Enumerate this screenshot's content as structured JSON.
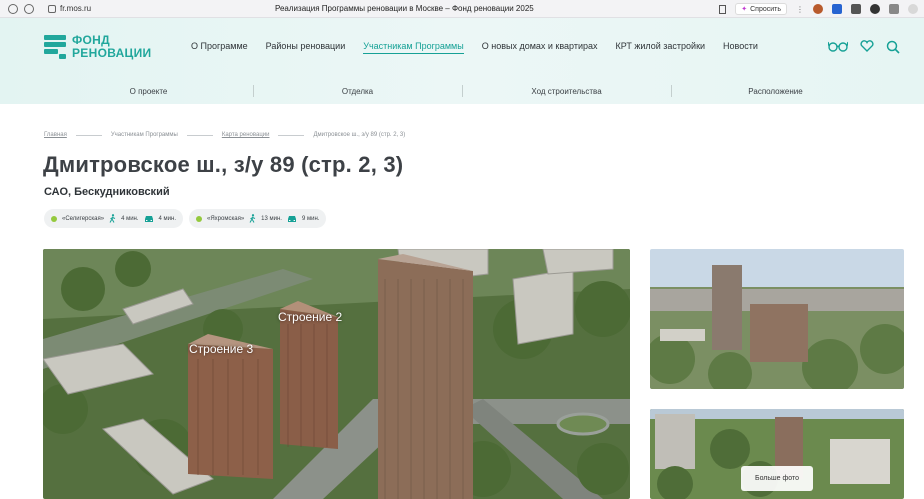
{
  "browser": {
    "url": "fr.mos.ru",
    "tab_title": "Реализация Программы реновации в Москве – Фонд реновации 2025",
    "ask_label": "Спросить"
  },
  "logo": {
    "line1": "ФОНД",
    "line2": "РЕНОВАЦИИ"
  },
  "main_nav": [
    {
      "label": "О Программе",
      "active": false
    },
    {
      "label": "Районы реновации",
      "active": false
    },
    {
      "label": "Участникам Программы",
      "active": true
    },
    {
      "label": "О новых домах и квартирах",
      "active": false
    },
    {
      "label": "КРТ жилой застройки",
      "active": false
    },
    {
      "label": "Новости",
      "active": false
    }
  ],
  "header_icons": [
    "glasses-icon",
    "heart-icon",
    "search-icon"
  ],
  "sub_nav": [
    "О проекте",
    "Отделка",
    "Ход строительства",
    "Расположение"
  ],
  "breadcrumb": [
    {
      "label": "Главная",
      "link": true
    },
    {
      "label": "Участникам Программы",
      "link": false
    },
    {
      "label": "Карта реновации",
      "link": true
    },
    {
      "label": "Дмитровское ш., з/у 89 (стр. 2, 3)",
      "link": false
    }
  ],
  "title": "Дмитровское ш., з/у 89 (стр. 2, 3)",
  "district": "САО, Бескудниковский",
  "metros": [
    {
      "name": "«Селигерская»",
      "walk": "4 мин.",
      "drive": "4 мин.",
      "color": "#94c93d"
    },
    {
      "name": "«Яхромская»",
      "walk": "13 мин.",
      "drive": "9 мин.",
      "color": "#94c93d"
    }
  ],
  "photo_labels": {
    "building2": "Строение 2",
    "building3": "Строение 3"
  },
  "more_photos": "Больше фото",
  "colors": {
    "accent": "#16a196",
    "metro_dot": "#94c93d"
  }
}
